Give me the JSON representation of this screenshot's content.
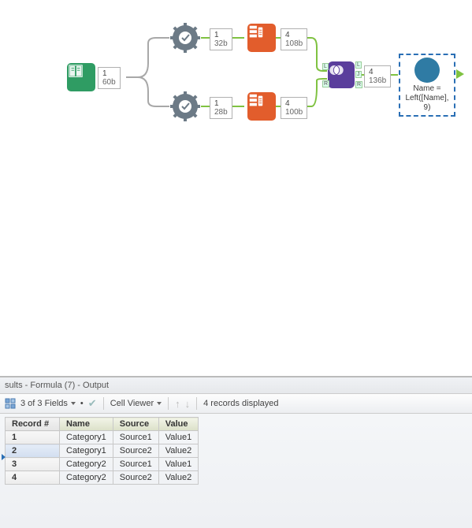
{
  "canvas": {
    "nodes": {
      "input": {
        "records": "1",
        "size": "60b"
      },
      "gear1": {
        "records": "1",
        "size": "32b"
      },
      "gear2": {
        "records": "1",
        "size": "28b"
      },
      "or1": {
        "records": "4",
        "size": "108b"
      },
      "or2": {
        "records": "4",
        "size": "100b"
      },
      "join": {
        "records": "4",
        "size": "136b"
      },
      "formula": {
        "caption": "Name = Left([Name], 9)"
      }
    },
    "join_ports": {
      "top_in": "L",
      "bot_in": "R",
      "out_top": "L",
      "out_mid": "J",
      "out_bot": "R"
    }
  },
  "results": {
    "title": "sults - Formula (7) - Output",
    "toolbar": {
      "fields_label": "3 of 3 Fields",
      "cellviewer_label": "Cell Viewer",
      "records_label": "4 records displayed"
    },
    "columns": [
      "Record #",
      "Name",
      "Source",
      "Value"
    ],
    "rows": [
      {
        "rn": "1",
        "Name": "Category1",
        "Source": "Source1",
        "Value": "Value1"
      },
      {
        "rn": "2",
        "Name": "Category1",
        "Source": "Source2",
        "Value": "Value2"
      },
      {
        "rn": "3",
        "Name": "Category2",
        "Source": "Source1",
        "Value": "Value1"
      },
      {
        "rn": "4",
        "Name": "Category2",
        "Source": "Source2",
        "Value": "Value2"
      }
    ]
  }
}
